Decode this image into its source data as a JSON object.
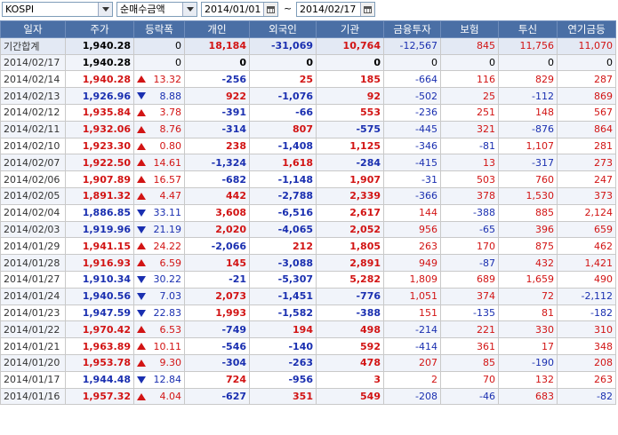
{
  "toolbar": {
    "index_select": "KOSPI",
    "type_select": "순매수금액",
    "start_date": "2014/01/01",
    "end_date": "2014/02/17",
    "range_separator": "~"
  },
  "columns": [
    "일자",
    "주가",
    "등락폭",
    "개인",
    "외국인",
    "기관",
    "금융투자",
    "보험",
    "투신",
    "연기금등"
  ],
  "rows": [
    {
      "date": "기간합계",
      "price": "1,940.28",
      "dir": "",
      "chg": "0",
      "indiv": "18,184",
      "foreign": "-31,069",
      "inst": "10,764",
      "fin": "-12,567",
      "ins": "845",
      "trust": "11,756",
      "pension": "11,070"
    },
    {
      "date": "2014/02/17",
      "price": "1,940.28",
      "dir": "",
      "chg": "0",
      "indiv": "0",
      "foreign": "0",
      "inst": "0",
      "fin": "0",
      "ins": "0",
      "trust": "0",
      "pension": "0"
    },
    {
      "date": "2014/02/14",
      "price": "1,940.28",
      "dir": "up",
      "chg": "13.32",
      "indiv": "-256",
      "foreign": "25",
      "inst": "185",
      "fin": "-664",
      "ins": "116",
      "trust": "829",
      "pension": "287"
    },
    {
      "date": "2014/02/13",
      "price": "1,926.96",
      "dir": "dn",
      "chg": "8.88",
      "indiv": "922",
      "foreign": "-1,076",
      "inst": "92",
      "fin": "-502",
      "ins": "25",
      "trust": "-112",
      "pension": "869"
    },
    {
      "date": "2014/02/12",
      "price": "1,935.84",
      "dir": "up",
      "chg": "3.78",
      "indiv": "-391",
      "foreign": "-66",
      "inst": "553",
      "fin": "-236",
      "ins": "251",
      "trust": "148",
      "pension": "567"
    },
    {
      "date": "2014/02/11",
      "price": "1,932.06",
      "dir": "up",
      "chg": "8.76",
      "indiv": "-314",
      "foreign": "807",
      "inst": "-575",
      "fin": "-445",
      "ins": "321",
      "trust": "-876",
      "pension": "864"
    },
    {
      "date": "2014/02/10",
      "price": "1,923.30",
      "dir": "up",
      "chg": "0.80",
      "indiv": "238",
      "foreign": "-1,408",
      "inst": "1,125",
      "fin": "-346",
      "ins": "-81",
      "trust": "1,107",
      "pension": "281"
    },
    {
      "date": "2014/02/07",
      "price": "1,922.50",
      "dir": "up",
      "chg": "14.61",
      "indiv": "-1,324",
      "foreign": "1,618",
      "inst": "-284",
      "fin": "-415",
      "ins": "13",
      "trust": "-317",
      "pension": "273"
    },
    {
      "date": "2014/02/06",
      "price": "1,907.89",
      "dir": "up",
      "chg": "16.57",
      "indiv": "-682",
      "foreign": "-1,148",
      "inst": "1,907",
      "fin": "-31",
      "ins": "503",
      "trust": "760",
      "pension": "247"
    },
    {
      "date": "2014/02/05",
      "price": "1,891.32",
      "dir": "up",
      "chg": "4.47",
      "indiv": "442",
      "foreign": "-2,788",
      "inst": "2,339",
      "fin": "-366",
      "ins": "378",
      "trust": "1,530",
      "pension": "373"
    },
    {
      "date": "2014/02/04",
      "price": "1,886.85",
      "dir": "dn",
      "chg": "33.11",
      "indiv": "3,608",
      "foreign": "-6,516",
      "inst": "2,617",
      "fin": "144",
      "ins": "-388",
      "trust": "885",
      "pension": "2,124"
    },
    {
      "date": "2014/02/03",
      "price": "1,919.96",
      "dir": "dn",
      "chg": "21.19",
      "indiv": "2,020",
      "foreign": "-4,065",
      "inst": "2,052",
      "fin": "956",
      "ins": "-65",
      "trust": "396",
      "pension": "659"
    },
    {
      "date": "2014/01/29",
      "price": "1,941.15",
      "dir": "up",
      "chg": "24.22",
      "indiv": "-2,066",
      "foreign": "212",
      "inst": "1,805",
      "fin": "263",
      "ins": "170",
      "trust": "875",
      "pension": "462"
    },
    {
      "date": "2014/01/28",
      "price": "1,916.93",
      "dir": "up",
      "chg": "6.59",
      "indiv": "145",
      "foreign": "-3,088",
      "inst": "2,891",
      "fin": "949",
      "ins": "-87",
      "trust": "432",
      "pension": "1,421"
    },
    {
      "date": "2014/01/27",
      "price": "1,910.34",
      "dir": "dn",
      "chg": "30.22",
      "indiv": "-21",
      "foreign": "-5,307",
      "inst": "5,282",
      "fin": "1,809",
      "ins": "689",
      "trust": "1,659",
      "pension": "490"
    },
    {
      "date": "2014/01/24",
      "price": "1,940.56",
      "dir": "dn",
      "chg": "7.03",
      "indiv": "2,073",
      "foreign": "-1,451",
      "inst": "-776",
      "fin": "1,051",
      "ins": "374",
      "trust": "72",
      "pension": "-2,112"
    },
    {
      "date": "2014/01/23",
      "price": "1,947.59",
      "dir": "dn",
      "chg": "22.83",
      "indiv": "1,993",
      "foreign": "-1,582",
      "inst": "-388",
      "fin": "151",
      "ins": "-135",
      "trust": "81",
      "pension": "-182"
    },
    {
      "date": "2014/01/22",
      "price": "1,970.42",
      "dir": "up",
      "chg": "6.53",
      "indiv": "-749",
      "foreign": "194",
      "inst": "498",
      "fin": "-214",
      "ins": "221",
      "trust": "330",
      "pension": "310"
    },
    {
      "date": "2014/01/21",
      "price": "1,963.89",
      "dir": "up",
      "chg": "10.11",
      "indiv": "-546",
      "foreign": "-140",
      "inst": "592",
      "fin": "-414",
      "ins": "361",
      "trust": "17",
      "pension": "348"
    },
    {
      "date": "2014/01/20",
      "price": "1,953.78",
      "dir": "up",
      "chg": "9.30",
      "indiv": "-304",
      "foreign": "-263",
      "inst": "478",
      "fin": "207",
      "ins": "85",
      "trust": "-190",
      "pension": "208"
    },
    {
      "date": "2014/01/17",
      "price": "1,944.48",
      "dir": "dn",
      "chg": "12.84",
      "indiv": "724",
      "foreign": "-956",
      "inst": "3",
      "fin": "2",
      "ins": "70",
      "trust": "132",
      "pension": "263"
    },
    {
      "date": "2014/01/16",
      "price": "1,957.32",
      "dir": "up",
      "chg": "4.04",
      "indiv": "-627",
      "foreign": "351",
      "inst": "549",
      "fin": "-208",
      "ins": "-46",
      "trust": "683",
      "pension": "-82"
    }
  ],
  "colors": {
    "header_bg": "#4a6fa5",
    "up": "#d21414",
    "down": "#1a2fb0",
    "row_alt": "#f1f4fa",
    "sum_row": "#e3e9f4"
  },
  "icons": {
    "dropdown": "chevron-down-icon",
    "calendar": "calendar-icon",
    "rise": "triangle-up-icon",
    "fall": "triangle-down-icon"
  }
}
